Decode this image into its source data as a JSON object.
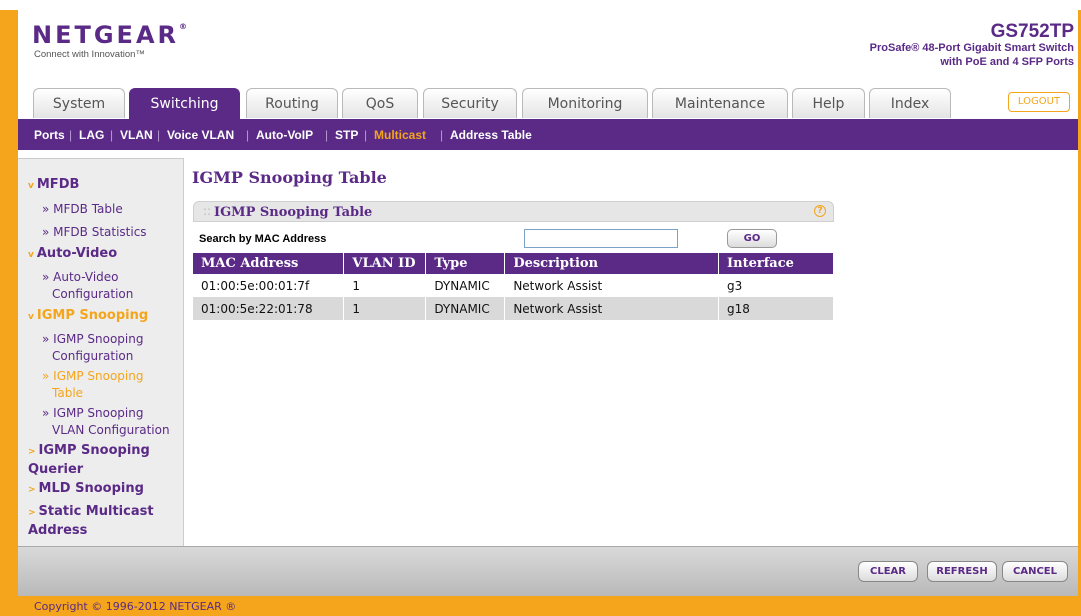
{
  "header": {
    "logo": "NETGEAR",
    "logo_mark": "®",
    "tagline": "Connect with Innovation™",
    "model": "GS752TP",
    "description_line1": "ProSafe® 48-Port Gigabit Smart Switch",
    "description_line2": "with PoE and 4 SFP Ports"
  },
  "tabs": [
    "System",
    "Switching",
    "Routing",
    "QoS",
    "Security",
    "Monitoring",
    "Maintenance",
    "Help",
    "Index"
  ],
  "active_tab": "Switching",
  "logout_label": "LOGOUT",
  "subnav": [
    "Ports",
    "LAG",
    "VLAN",
    "Voice VLAN",
    "Auto-VoIP",
    "STP",
    "Multicast",
    "Address Table"
  ],
  "active_subnav": "Multicast",
  "sidebar": {
    "mfdb": "MFDB",
    "mfdb_table": "» MFDB Table",
    "mfdb_statistics": "» MFDB Statistics",
    "auto_video": "Auto-Video",
    "auto_video_config_1": "» Auto-Video",
    "auto_video_config_2": "Configuration",
    "igmp_snooping": "IGMP Snooping",
    "igmp_config_1": "» IGMP Snooping",
    "igmp_config_2": "Configuration",
    "igmp_table_1": "» IGMP Snooping",
    "igmp_table_2": "Table",
    "igmp_vlan_1": "» IGMP Snooping",
    "igmp_vlan_2": "VLAN Configuration",
    "querier_1": "IGMP Snooping",
    "querier_2": "Querier",
    "mld": "MLD Snooping",
    "static_1": "Static Multicast",
    "static_2": "Address"
  },
  "page_title": "IGMP Snooping Table",
  "panel": {
    "title": "IGMP Snooping Table",
    "search_label": "Search by MAC Address",
    "search_value": "",
    "go_label": "GO"
  },
  "table": {
    "columns": [
      "MAC Address",
      "VLAN ID",
      "Type",
      "Description",
      "Interface"
    ],
    "rows": [
      [
        "01:00:5e:00:01:7f",
        "1",
        "DYNAMIC",
        "Network Assist",
        "g3"
      ],
      [
        "01:00:5e:22:01:78",
        "1",
        "DYNAMIC",
        "Network Assist",
        "g18"
      ]
    ]
  },
  "buttons": {
    "clear": "CLEAR",
    "refresh": "REFRESH",
    "cancel": "CANCEL"
  },
  "copyright": "Copyright © 1996-2012 NETGEAR ®",
  "colors": {
    "brand_purple": "#5a2a86",
    "accent_orange": "#f4a51c"
  }
}
